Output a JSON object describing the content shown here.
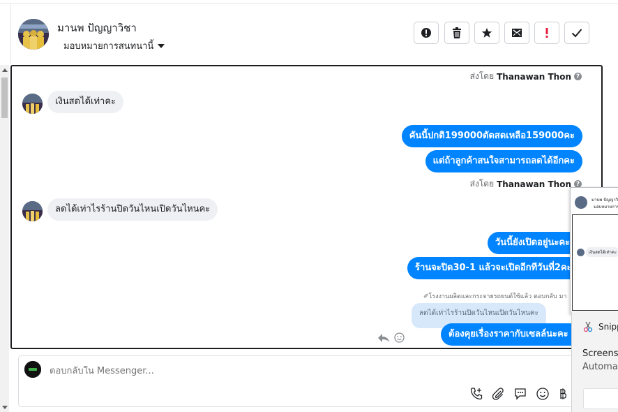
{
  "header": {
    "contact_name": "มานพ ปัญญาวิชา",
    "assign_label": "มอบหมายการสนทนานี้",
    "toolbar": [
      {
        "name": "mark-important-button",
        "icon": "alert-circle-icon"
      },
      {
        "name": "delete-button",
        "icon": "trash-icon"
      },
      {
        "name": "star-button",
        "icon": "star-icon"
      },
      {
        "name": "mark-unread-button",
        "icon": "envelope-icon"
      },
      {
        "name": "spam-button",
        "icon": "exclamation-icon"
      },
      {
        "name": "done-button",
        "icon": "check-icon"
      }
    ]
  },
  "conversation": {
    "sent_by_prefix": "ส่งโดย",
    "sent_by_name": "Thanawan Thon",
    "help_glyph": "?",
    "messages": [
      {
        "dir": "in",
        "text": "เงินสดได้เท่าคะ"
      },
      {
        "dir": "out",
        "text": "คันนี้ปกติ199000ตัดสดเหลือ159000คะ"
      },
      {
        "dir": "out",
        "text": "แต่ถ้าลูกค้าสนใจสามารถลดได้อีกคะ"
      },
      {
        "dir": "in",
        "text": "ลดได้เท่าไรร้านปิดวันไหนเปิดวันไหนคะ"
      },
      {
        "dir": "out",
        "text": "วันนี้ยังเปิดอยู่นะคะ"
      },
      {
        "dir": "out",
        "text": "ร้านจะปิด30-1 แล้วจะเปิดอีกทีวันที่2คะ"
      },
      {
        "dir": "out",
        "text": "ต้องคุยเรื่องราคากับเซลล์นะคะ"
      }
    ],
    "reply_context": "โรงงานผลิตและกระจายรถยนต์ใช้แล้ว ตอบกลับ มา",
    "reply_quote": "ลดได้เท่าไรร้านปิดวันไหนเปิดวันไหนคะ"
  },
  "composer": {
    "placeholder": "ตอบกลับใน Messenger..."
  },
  "popup": {
    "name_snippet": "มานพ ปัญญาวิ",
    "assign_snippet": "มอบหมายการ",
    "msg_snippet": "เงินสดได้เท่าคะ"
  },
  "snip_notice": {
    "app": "Snipp",
    "line1": "Screensh",
    "line2": "Automat"
  }
}
